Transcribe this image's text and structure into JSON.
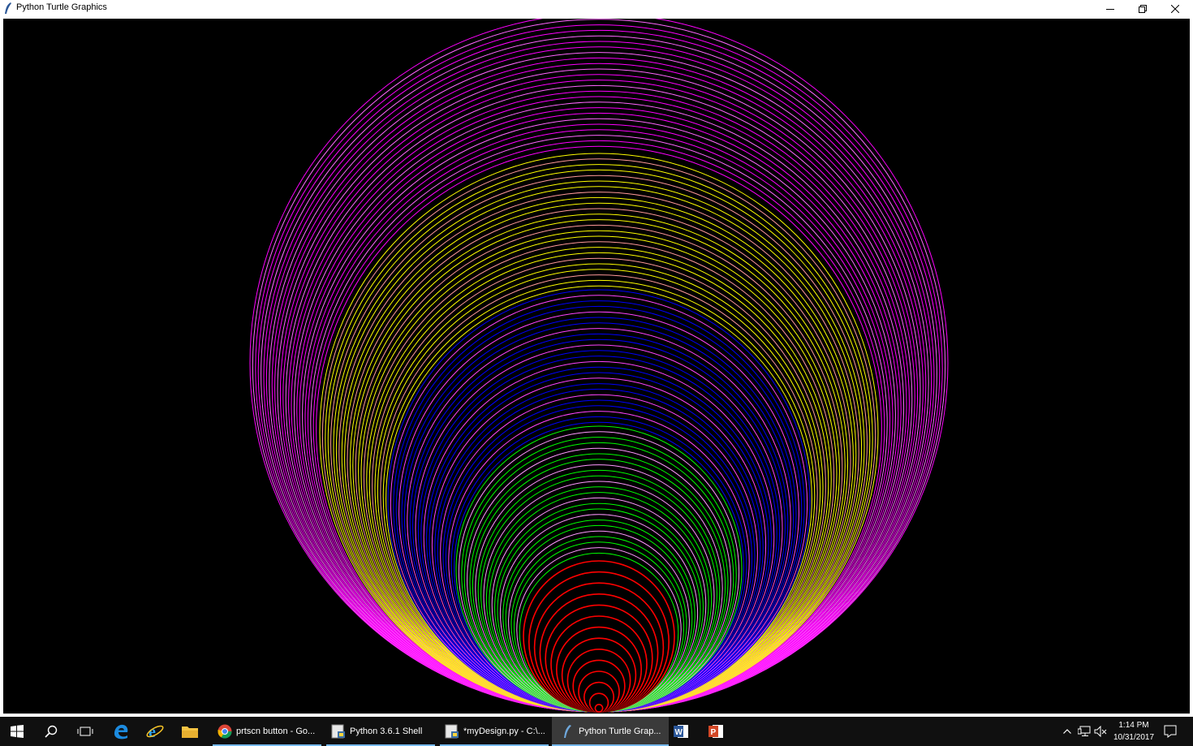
{
  "window": {
    "title": "Python Turtle Graphics"
  },
  "drawing": {
    "background": "#000000",
    "ring_colors": [
      "#ff00ff",
      "#ffff00",
      "#ff8888",
      "#0000ff",
      "#ff00ff",
      "#00ff00",
      "#ff0000",
      "#000000"
    ],
    "bands": [
      {
        "color": "#ff00ff",
        "alt": "#ff66ff"
      },
      {
        "color": "#ffff00",
        "alt": "#ff9999"
      },
      {
        "color": "#0000ff",
        "alt": "#ff44ff"
      },
      {
        "color": "#00ff00",
        "alt": "#ff99ff"
      },
      {
        "color": "#ff0000",
        "alt": "#000000"
      }
    ]
  },
  "taskbar": {
    "apps": [
      {
        "label": "prtscn button - Go...",
        "icon": "chrome-icon"
      },
      {
        "label": "Python 3.6.1 Shell",
        "icon": "python-shell-icon"
      },
      {
        "label": "*myDesign.py - C:\\...",
        "icon": "python-editor-icon"
      },
      {
        "label": "Python Turtle Grap...",
        "icon": "turtle-icon"
      }
    ],
    "clock": {
      "time": "1:14 PM",
      "date": "10/31/2017"
    }
  }
}
